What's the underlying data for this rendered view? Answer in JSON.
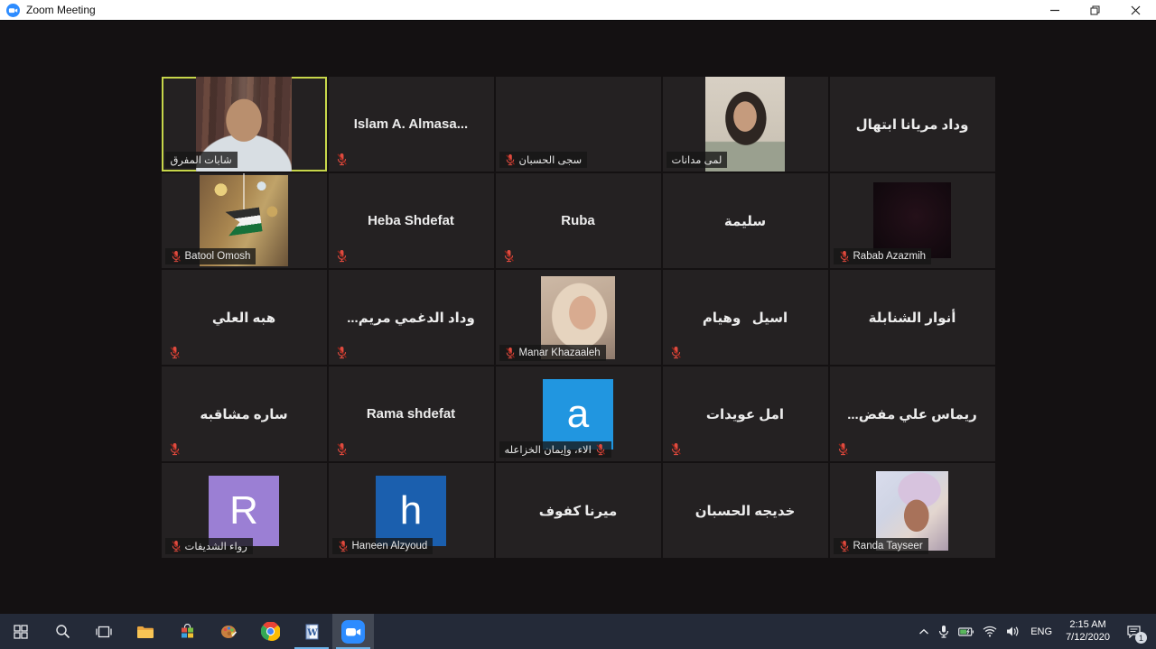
{
  "window": {
    "title": "Zoom Meeting",
    "app_icon": "zoom-camera",
    "controls": [
      "minimize",
      "restore",
      "close"
    ]
  },
  "colors": {
    "accent_blue": "#2d8cff",
    "active_speaker_border": "#c7d64a",
    "muted_mic_red": "#e04b3f",
    "taskbar": "#242a38"
  },
  "meeting": {
    "layout": "gallery-view",
    "columns": 5,
    "rows": 5,
    "active_speaker": "شابات المفرق",
    "participants": [
      {
        "name": "شابات المفرق",
        "kind": "video",
        "video": "man-room",
        "muted": false,
        "active": true
      },
      {
        "name": "Islam A. Almasa...",
        "kind": "name",
        "muted": true
      },
      {
        "name": "سجى الحسبان",
        "kind": "label",
        "muted": true
      },
      {
        "name": "لمى مدانات",
        "kind": "video",
        "video": "girl-portrait",
        "muted": false
      },
      {
        "name": "وداد مريانا ابتهال",
        "kind": "name",
        "muted": false
      },
      {
        "name": "Batool Omosh",
        "kind": "video",
        "video": "flag-pendant",
        "muted": true
      },
      {
        "name": "Heba Shdefat",
        "kind": "name",
        "muted": true
      },
      {
        "name": "Ruba",
        "kind": "name",
        "muted": true
      },
      {
        "name": "سليمة",
        "kind": "name",
        "muted": false
      },
      {
        "name": "Rabab Azazmih",
        "kind": "video",
        "video": "dark-room",
        "muted": true
      },
      {
        "name": "هبه العلي",
        "kind": "name",
        "muted": true
      },
      {
        "name": "وداد الدغمي مريم...",
        "kind": "name",
        "muted": true
      },
      {
        "name": "Manar Khazaaleh",
        "kind": "video",
        "video": "hijab-portrait",
        "muted": true
      },
      {
        "name": "اسيل   وهيام",
        "kind": "name",
        "muted": true
      },
      {
        "name": "أنوار الشنابلة",
        "kind": "name",
        "muted": false
      },
      {
        "name": "ساره مشاقبه",
        "kind": "name",
        "muted": true
      },
      {
        "name": "Rama shdefat",
        "kind": "name",
        "muted": true
      },
      {
        "name": "الاء، وإيمان الخزاعله",
        "kind": "avatar",
        "avatar_letter": "a",
        "avatar_color": "#2196e0",
        "muted": true,
        "mic_after": true
      },
      {
        "name": "امل عويدات",
        "kind": "name",
        "muted": true
      },
      {
        "name": "ريماس علي مفض...",
        "kind": "name",
        "muted": true
      },
      {
        "name": "رواء الشديفات",
        "kind": "avatar",
        "avatar_letter": "R",
        "avatar_color": "#9b7fd4",
        "muted": true
      },
      {
        "name": "Haneen Alzyoud",
        "kind": "avatar",
        "avatar_letter": "h",
        "avatar_color": "#1b5fae",
        "muted": true
      },
      {
        "name": "ميرنا كفوف",
        "kind": "name",
        "muted": false
      },
      {
        "name": "خديجه الحسبان",
        "kind": "name",
        "muted": false
      },
      {
        "name": "Randa Tayseer",
        "kind": "video",
        "video": "selfie",
        "muted": true
      }
    ]
  },
  "taskbar": {
    "buttons": [
      {
        "name": "start",
        "icon": "windows-logo"
      },
      {
        "name": "search",
        "icon": "search"
      },
      {
        "name": "task-view",
        "icon": "task-view"
      },
      {
        "name": "file-explorer",
        "icon": "folder"
      },
      {
        "name": "microsoft-store",
        "icon": "store-bag"
      },
      {
        "name": "paint-3d",
        "icon": "palette"
      },
      {
        "name": "chrome",
        "icon": "chrome"
      },
      {
        "name": "word",
        "icon": "word-document",
        "running": true
      },
      {
        "name": "zoom",
        "icon": "zoom-camera",
        "running": true,
        "active": true
      }
    ],
    "tray": {
      "chevron_icon": "chevron-up",
      "icons": [
        "microphone",
        "battery-charging",
        "wifi",
        "volume"
      ],
      "language": "ENG",
      "time": "2:15 AM",
      "date": "7/12/2020",
      "notification_count": "1"
    }
  }
}
